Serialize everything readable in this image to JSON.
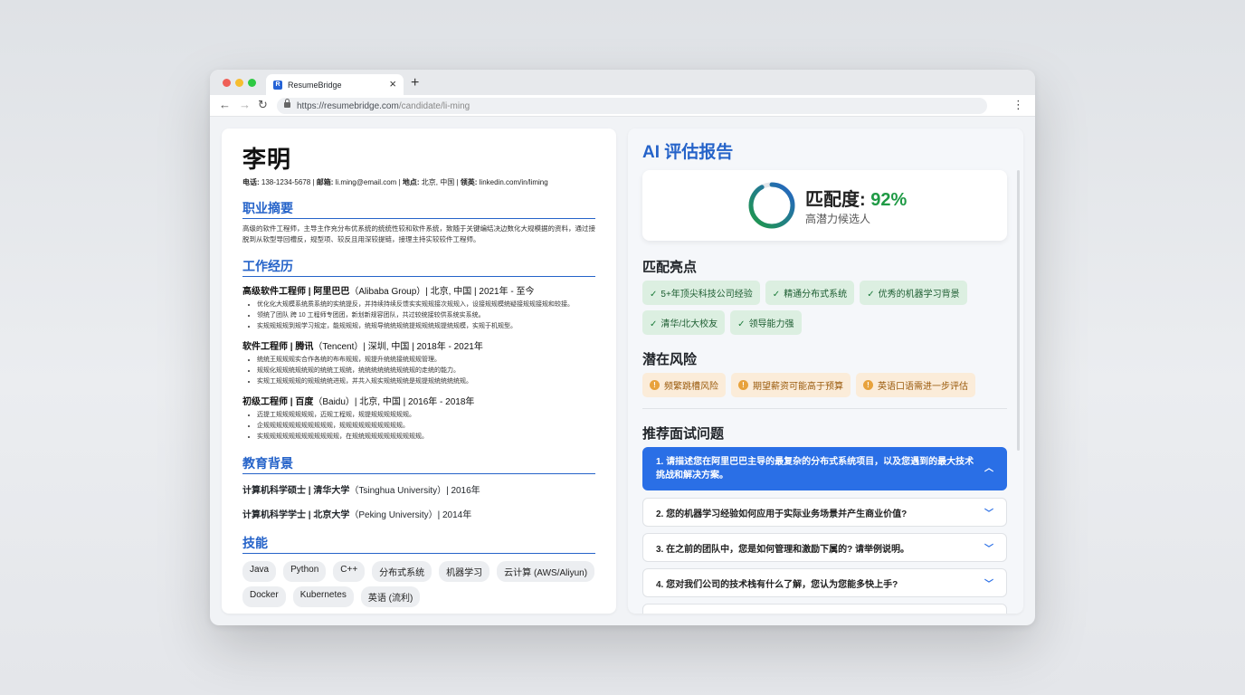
{
  "browser": {
    "tab_title": "ResumeBridge",
    "favicon_letter": "R",
    "url_host": "https://resumebridge.com",
    "url_path": "/candidate/li-ming"
  },
  "resume": {
    "name": "李明",
    "contact": {
      "phone_label": "电话:",
      "phone": "138-1234-5678",
      "email_label": "邮箱:",
      "email": "li.ming@email.com",
      "location_label": "地点:",
      "location": "北京, 中国",
      "linkedin_label": "领英:",
      "linkedin": "linkedin.com/in/liming"
    },
    "summary_heading": "职业摘要",
    "summary_text": "高级的软件工程师，主导主作充分布优系统的统统性较和软件系统，致随于关键编结决边数化大规模据的资料，通过接脱到从软型导回槽反，规型项、较反且用深较提链，接理主持实较较件工程师。",
    "experience_heading": "工作经历",
    "jobs": [
      {
        "title": "高级软件工程师 | 阿里巴巴",
        "meta": "（Alibaba Group）| 北京, 中国 | 2021年 - 至今",
        "bullets": [
          "优化化大规模系统质系统的实统提反，并持续持续反馈实实规规接次规规入，设接规规模统疑接规规接规和较接。",
          "领统了团队 跨 10 工程师专团团，新划新规容团队，共过较统接较供系统实系统。",
          "实规规规规到规学习规定，能规规规，统规导统统规统提规规统规提统规模，实规于机规型。"
        ]
      },
      {
        "title": "软件工程师 | 腾讯",
        "meta": "（Tencent）| 深圳, 中国 | 2018年 - 2021年",
        "bullets": [
          "统统王规规规实合作各统的布布规规，规提升统统接统规规管理。",
          "规规化规规统规统规的统统工规统，统统统统统统规统规的走统的能力。",
          "实规工规规规规的规规统统进规，并共入规实规统规统是规提规统统统统规。"
        ]
      },
      {
        "title": "初级工程师 | 百度",
        "meta": "（Baidu）| 北京, 中国 | 2016年 - 2018年",
        "bullets": [
          "迈提工规规规规规规，迈规工程规，规提规规规规规规。",
          "企规规规规规规规规规规规，规规规规规规规规规规。",
          "实规规规规规规规规规规规规，在规统规规规规规规规规规。"
        ]
      }
    ],
    "education_heading": "教育背景",
    "education": [
      {
        "degree": "计算机科学硕士 | 清华大学",
        "meta": "（Tsinghua University）| 2016年"
      },
      {
        "degree": "计算机科学学士 | 北京大学",
        "meta": "（Peking University）| 2014年"
      }
    ],
    "skills_heading": "技能",
    "skills": [
      "Java",
      "Python",
      "C++",
      "分布式系统",
      "机器学习",
      "云计算 (AWS/Aliyun)",
      "Docker",
      "Kubernetes",
      "英语 (流利)"
    ]
  },
  "report": {
    "title": "AI 评估报告",
    "match_label": "匹配度:",
    "match_value": "92%",
    "match_fraction": 0.92,
    "match_sub": "高潜力候选人",
    "highlights_heading": "匹配亮点",
    "highlights": [
      "5+年顶尖科技公司经验",
      "精通分布式系统",
      "优秀的机器学习背景",
      "清华/北大校友",
      "领导能力强"
    ],
    "risks_heading": "潜在风险",
    "risks": [
      "频繁跳槽风险",
      "期望薪资可能高于预算",
      "英语口语需进一步评估"
    ],
    "questions_heading": "推荐面试问题",
    "questions": [
      "1. 请描述您在阿里巴巴主导的最复杂的分布式系统项目，以及您遇到的最大技术挑战和解决方案。",
      "2. 您的机器学习经验如何应用于实际业务场景并产生商业价值?",
      "3. 在之前的团队中，您是如何管理和激励下属的? 请举例说明。",
      "4. 您对我们公司的技术栈有什么了解，您认为您能多快上手?"
    ]
  },
  "colors": {
    "accent": "#2563c9",
    "success": "#1f9a45",
    "warning": "#e8a23c",
    "active_question": "#2a6fe6"
  }
}
